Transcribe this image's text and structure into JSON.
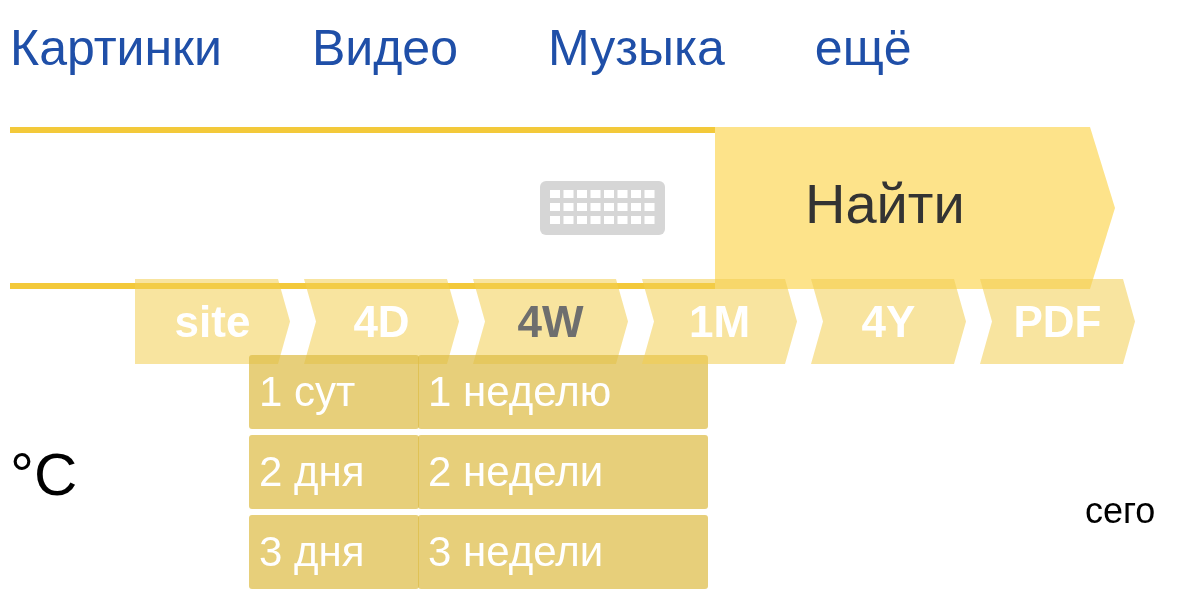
{
  "nav": [
    {
      "label": "Картинки"
    },
    {
      "label": "Видео"
    },
    {
      "label": "Музыка"
    },
    {
      "label": "ещё"
    }
  ],
  "search": {
    "button": "Найти"
  },
  "chips": [
    {
      "label": "site",
      "selected": false
    },
    {
      "label": "4D",
      "selected": false,
      "options": [
        "1 сут",
        "2 дня",
        "3 дня"
      ]
    },
    {
      "label": "4W",
      "selected": true,
      "options": [
        "1 неделю",
        "2 недели",
        "3 недели"
      ]
    },
    {
      "label": "1M",
      "selected": false
    },
    {
      "label": "4Y",
      "selected": false
    },
    {
      "label": "PDF",
      "selected": false
    }
  ],
  "weather": {
    "unit": "°C"
  },
  "rates": {
    "heading": "сего"
  }
}
